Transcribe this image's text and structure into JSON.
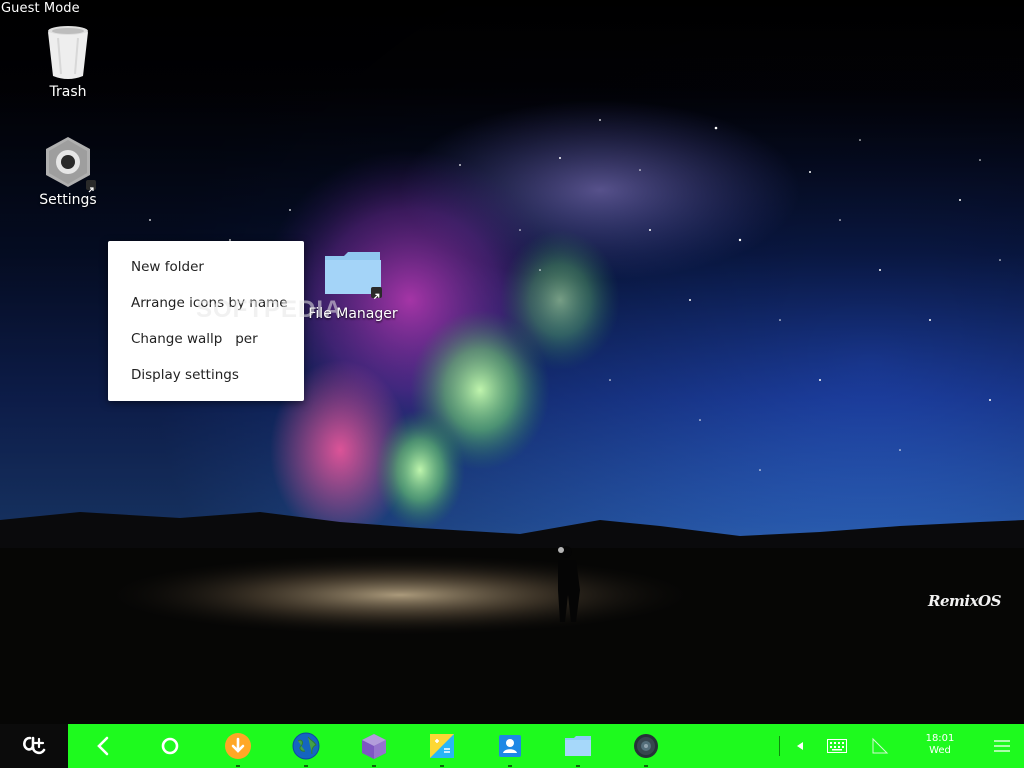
{
  "session": {
    "mode_label": "Guest Mode"
  },
  "desktop": {
    "icons": [
      {
        "label": "Trash"
      },
      {
        "label": "Settings"
      },
      {
        "label": "File Manager"
      }
    ]
  },
  "context_menu": {
    "items": [
      {
        "label": "New folder"
      },
      {
        "label": "Arrange icons by name"
      },
      {
        "label": "Change wallp   per"
      },
      {
        "label": "Display settings"
      }
    ]
  },
  "watermark": "SOFTPEDIA",
  "brand": "RemixOS",
  "taskbar": {
    "accent_color": "#1efa1e",
    "start_icon": "remix-logo-icon",
    "nav": [
      "back-icon",
      "home-icon"
    ],
    "apps": [
      "download-icon",
      "browser-globe-icon",
      "cube-app-icon",
      "notes-app-icon",
      "contacts-app-icon",
      "folder-app-icon",
      "music-player-icon"
    ],
    "tray": [
      "collapse-arrow-icon",
      "keyboard-icon",
      "signal-icon"
    ],
    "clock": {
      "time": "18:01",
      "day": "Wed"
    },
    "notifications_icon": "menu-lines-icon"
  }
}
